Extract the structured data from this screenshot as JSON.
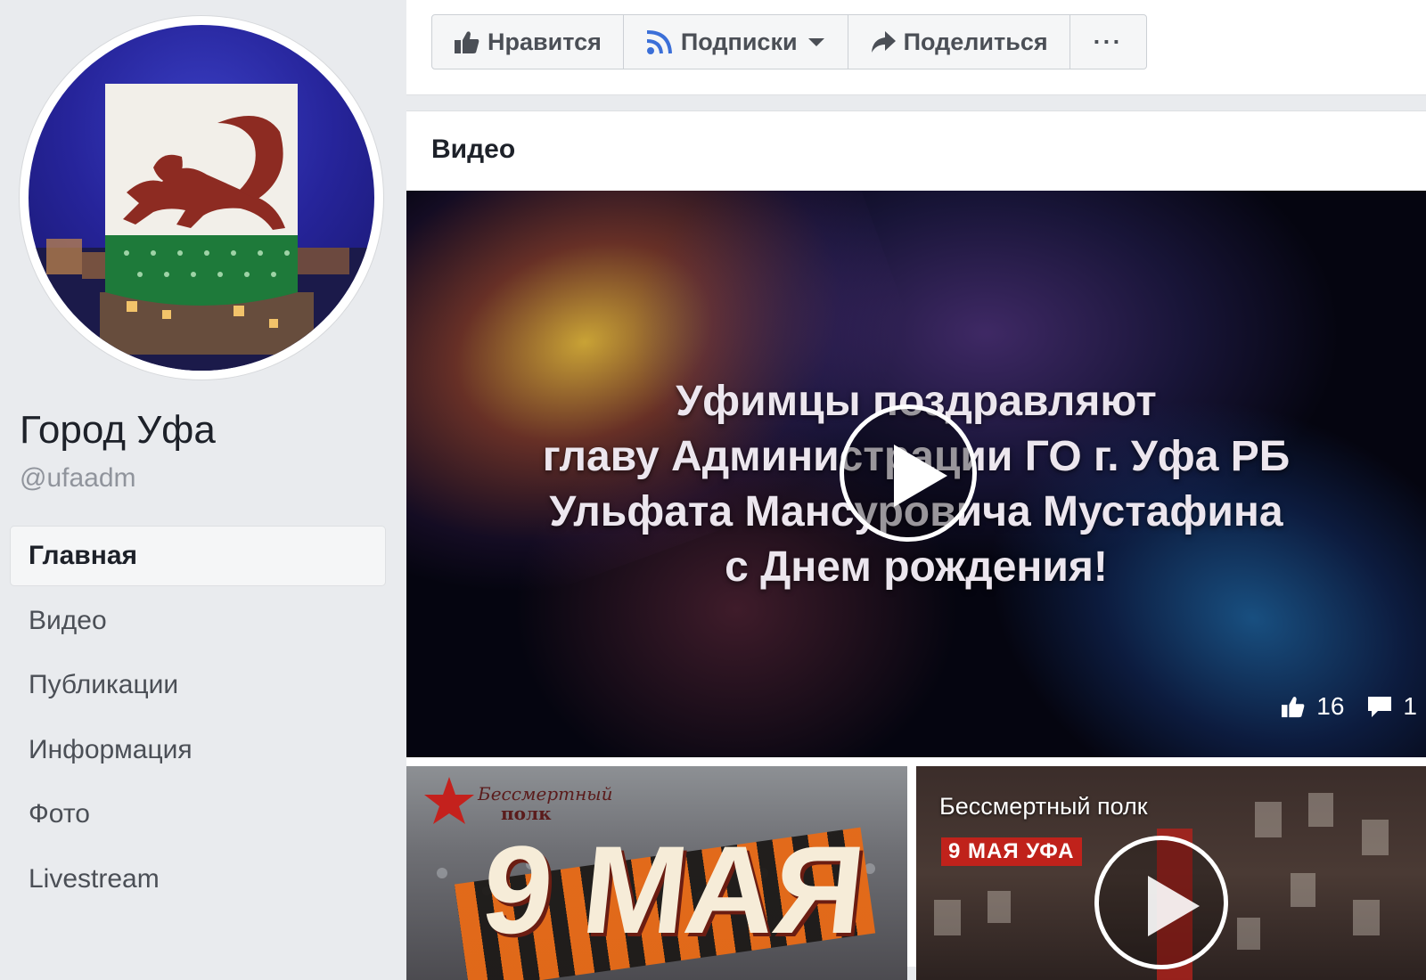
{
  "page": {
    "name": "Город Уфа",
    "handle": "@ufaadm"
  },
  "nav": {
    "items": [
      {
        "label": "Главная",
        "active": true
      },
      {
        "label": "Видео"
      },
      {
        "label": "Публикации"
      },
      {
        "label": "Информация"
      },
      {
        "label": "Фото"
      },
      {
        "label": "Livestream"
      }
    ]
  },
  "actions": {
    "like_label": "Нравится",
    "follow_label": "Подписки",
    "share_label": "Поделиться",
    "more_label": "···"
  },
  "videos_section": {
    "title": "Видео",
    "featured": {
      "overlay_lines": [
        "Уфимцы поздравляют",
        "главу Администрации ГО г. Уфа РБ",
        "Ульфата Мансуровича Мустафина",
        "с Днем рождения!"
      ],
      "likes": "16",
      "comments": "1"
    },
    "thumbs": [
      {
        "logo_text_1": "Бессмертный",
        "logo_text_2": "полк",
        "big_text": "9 МАЯ"
      },
      {
        "caption": "Бессмертный полк",
        "badge": "9 МАЯ  УФА"
      }
    ]
  },
  "colors": {
    "page_bg": "#e9ebee",
    "text_dark": "#1d2129",
    "text_muted": "#90949c",
    "button_bg": "#f5f6f7"
  }
}
